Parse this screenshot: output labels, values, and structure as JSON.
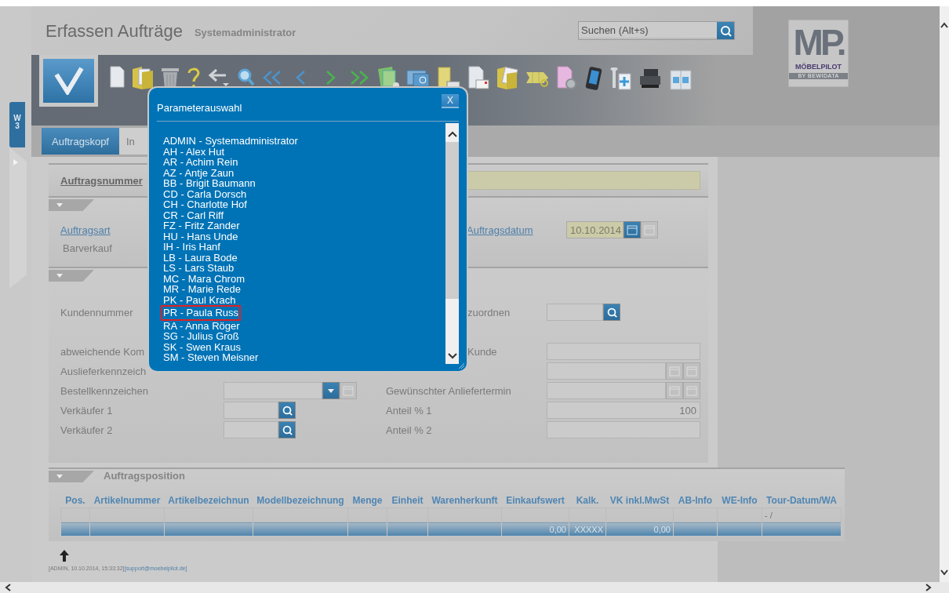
{
  "header": {
    "title": "Erfassen Aufträge",
    "user": "Systemadministrator",
    "search": {
      "placeholder": "Suchen (Alt+s)"
    }
  },
  "logo": {
    "mark": "MP.",
    "name": "MÖBELPILOT",
    "tagline": "BY BEWIDATA"
  },
  "side_tab": {
    "letter": "W",
    "count": "3"
  },
  "tabs": [
    {
      "label": "Auftragskopf",
      "selected": true
    },
    {
      "label": "In",
      "selected": false
    }
  ],
  "order_number": {
    "label": "Auftragsnummer"
  },
  "order_type": {
    "label": "Auftragsart",
    "value": "Barverkauf"
  },
  "order_date": {
    "label": "Auftragsdatum",
    "value": "10.10.2014"
  },
  "fields": [
    {
      "label": "Kundennummer",
      "label_2": "zuordnen",
      "kind": "lookup"
    },
    {
      "label": "abweichende Kom",
      "label_2": "Kunde",
      "kind": "text"
    },
    {
      "label": "Auslieferkennzeich",
      "kind": "date"
    },
    {
      "label": "Bestellkennzeichen",
      "left_field": {
        "kind": "dropdown"
      },
      "label_2": "Gewünschter Anliefertermin",
      "kind": "date"
    },
    {
      "label": "Verkäufer 1",
      "left_field": {
        "kind": "lookup"
      },
      "label_2": "Anteil % 1",
      "kind": "text",
      "value": "100"
    },
    {
      "label": "Verkäufer 2",
      "left_field": {
        "kind": "lookup"
      },
      "label_2": "Anteil % 2",
      "kind": "text"
    }
  ],
  "positions": {
    "title": "Auftragsposition",
    "columns": [
      "Pos.",
      "Artikelnummer",
      "Artikelbezeichnun",
      "Modellbezeichnung",
      "Menge",
      "Einheit",
      "Warenherkunft",
      "Einkaufswert",
      "Kalk.",
      "VK inkl.MwSt",
      "AB-Info",
      "WE-Info",
      "Tour-Datum/WA"
    ],
    "rows": [
      {
        "kind": "item",
        "cells": [
          null,
          null,
          null,
          null,
          null,
          null,
          null,
          null,
          null,
          null,
          null,
          null,
          "- /"
        ]
      },
      {
        "kind": "total",
        "cells": [
          null,
          null,
          null,
          null,
          null,
          null,
          null,
          "0,00",
          "XXXXX",
          "0,00",
          null,
          null,
          null
        ]
      }
    ]
  },
  "footer": {
    "info": "[ADMIN, 10.10.2014, 15:33:32]",
    "email": "[support@moebelpilot.de]"
  },
  "dialog": {
    "title": "Parameterauswahl",
    "close": "X",
    "items": [
      {
        "label": "ADMIN - Systemadministrator",
        "selected": false
      },
      {
        "label": "AH - Alex Hut",
        "selected": false
      },
      {
        "label": "AR - Achim Rein",
        "selected": false
      },
      {
        "label": "AZ - Antje Zaun",
        "selected": false
      },
      {
        "label": "BB - Brigit Baumann",
        "selected": false
      },
      {
        "label": "CD - Carla Dorsch",
        "selected": false
      },
      {
        "label": "CH - Charlotte Hof",
        "selected": false
      },
      {
        "label": "CR - Carl Riff",
        "selected": false
      },
      {
        "label": "FZ - Fritz Zander",
        "selected": false
      },
      {
        "label": "HU - Hans Unde",
        "selected": false
      },
      {
        "label": "IH - Iris Hanf",
        "selected": false
      },
      {
        "label": "LB - Laura Bode",
        "selected": false
      },
      {
        "label": "LS - Lars Staub",
        "selected": false
      },
      {
        "label": "MC - Mara Chrom",
        "selected": false
      },
      {
        "label": "MR - Marie Rede",
        "selected": false
      },
      {
        "label": "PK - Paul Krach",
        "selected": false
      },
      {
        "label": "PR - Paula Russ",
        "selected": true
      },
      {
        "label": "RA - Anna Röger",
        "selected": false
      },
      {
        "label": "SG - Julius Groß",
        "selected": false
      },
      {
        "label": "SK - Swen Kraus",
        "selected": false
      },
      {
        "label": "SM - Steven Meisner",
        "selected": false
      }
    ]
  }
}
